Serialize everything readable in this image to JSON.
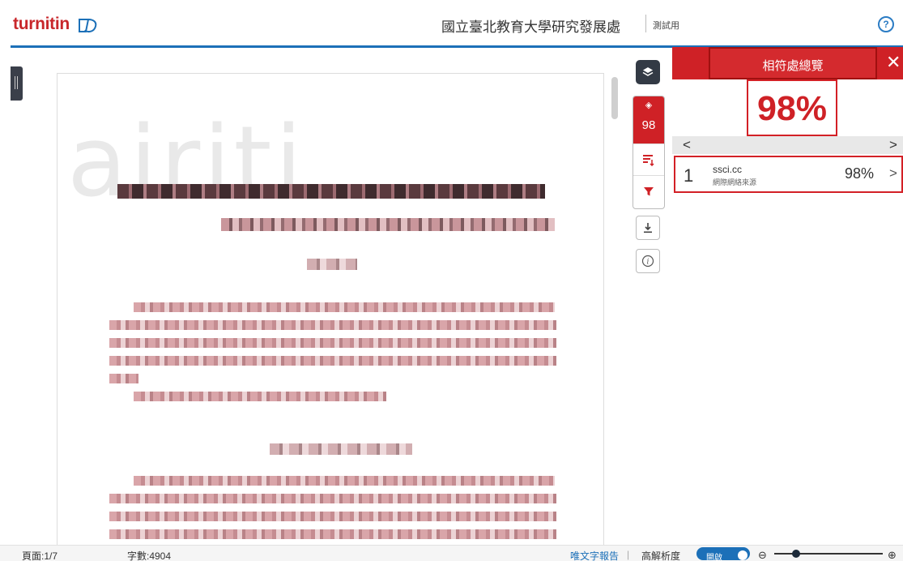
{
  "header": {
    "logo": "turnitin",
    "institution": "國立臺北教育大學研究發展處",
    "mode": "測試用",
    "help_icon": "question-circle-icon"
  },
  "document": {
    "watermark": "airiti"
  },
  "toolbar": {
    "layers_icon": "layers-icon",
    "score": "98",
    "sort_icon": "sort-icon",
    "filter_icon": "filter-icon",
    "download_icon": "download-icon",
    "info_icon": "info-icon"
  },
  "panel": {
    "title": "相符處總覽",
    "percent": "98%",
    "prev": "<",
    "next": ">",
    "match": {
      "index": "1",
      "source": "ssci.cc",
      "type": "網際網絡來源",
      "percent": "98%",
      "arrow": ">"
    }
  },
  "statusbar": {
    "page": "頁面:1/7",
    "words": "字數:4904",
    "text_report": "唯文字報告",
    "separator": "|",
    "hires": "高解析度",
    "toggle_state": "開啟",
    "zoom_level_fraction": 0.2
  },
  "colors": {
    "brand_red": "#cf2126",
    "accent_blue": "#1c70b8",
    "toolbar_dark": "#333a45"
  }
}
